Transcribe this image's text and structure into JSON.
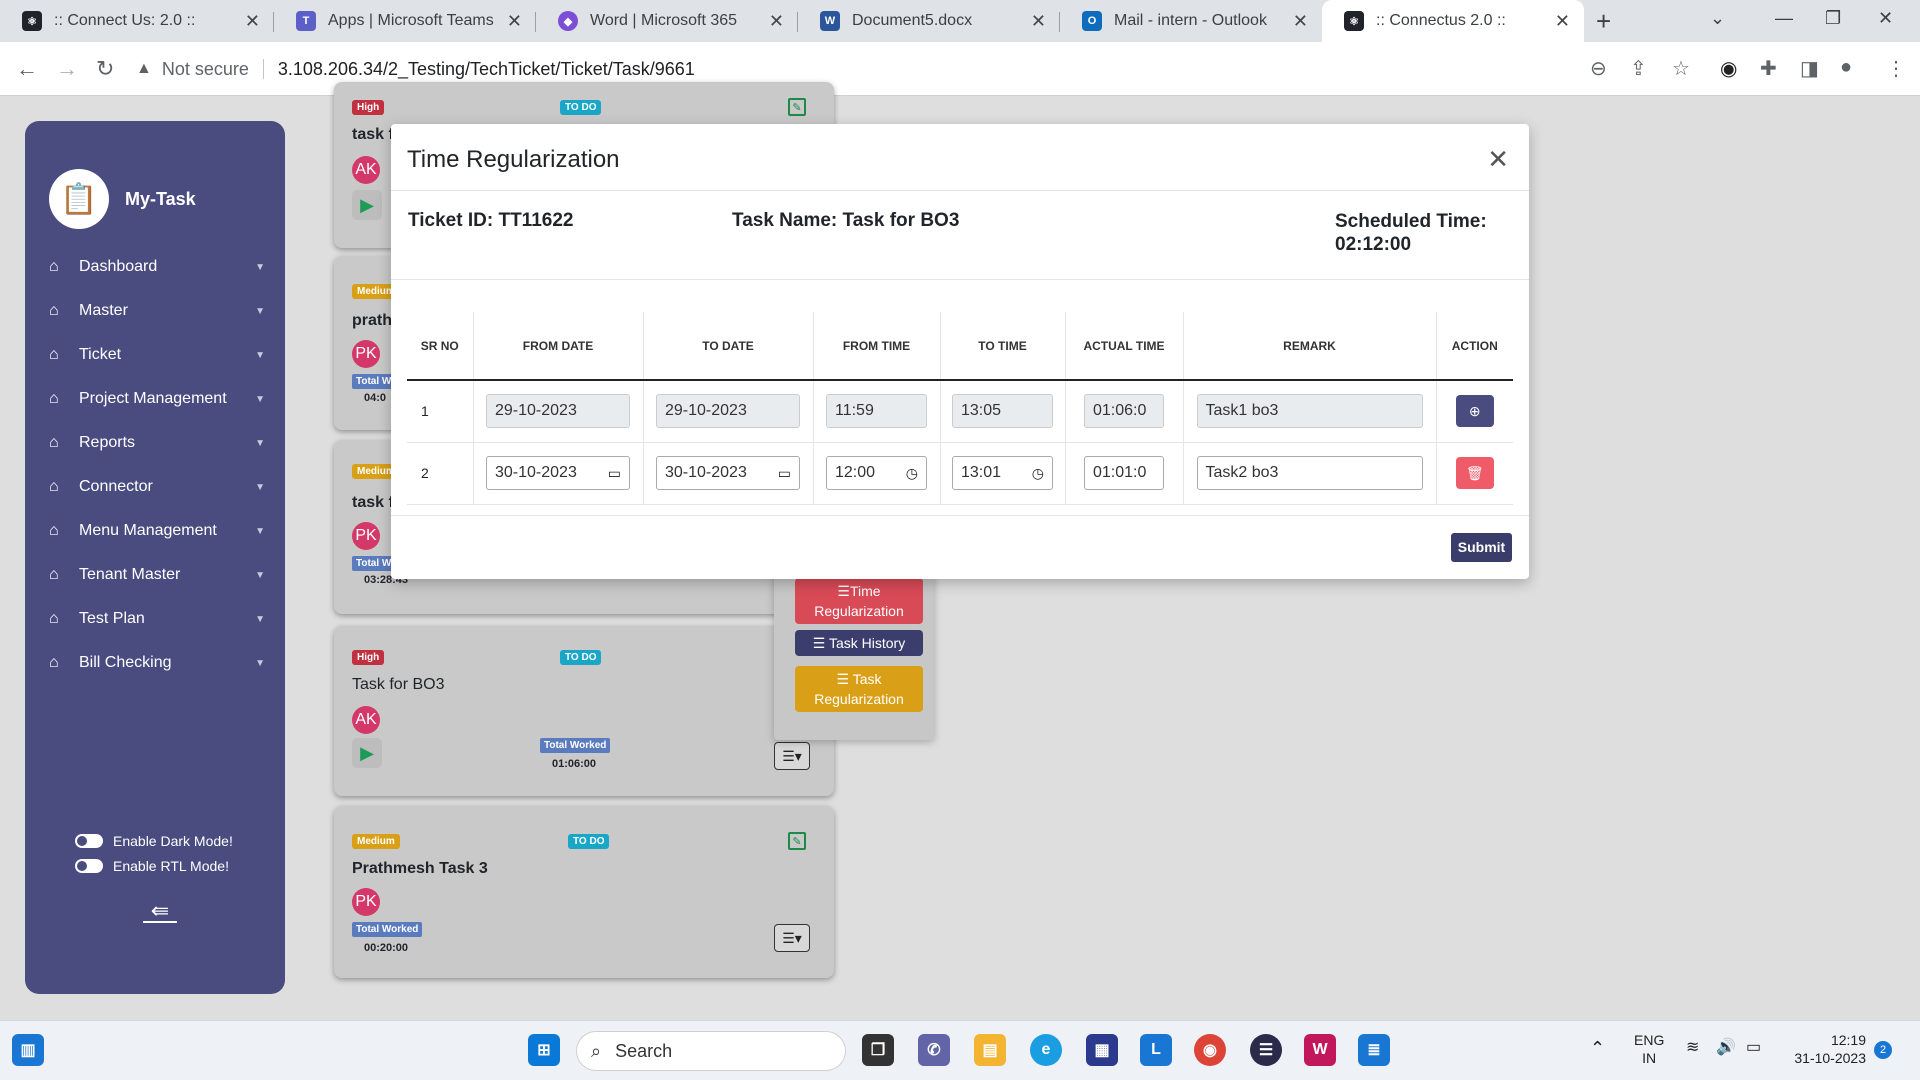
{
  "browser": {
    "tabs": [
      {
        "title": ":: Connect Us: 2.0 ::",
        "icon": "react-icon",
        "color": "#20232a"
      },
      {
        "title": "Apps | Microsoft Teams cla",
        "icon": "teams-icon",
        "color": "#5b5fc7"
      },
      {
        "title": "Word | Microsoft 365",
        "icon": "m365-icon",
        "color": "#7b4fd6"
      },
      {
        "title": "Document5.docx",
        "icon": "word-icon",
        "color": "#2b579a"
      },
      {
        "title": "Mail - intern - Outlook",
        "icon": "outlook-icon",
        "color": "#0f6cbd"
      },
      {
        "title": ":: Connectus 2.0 ::",
        "icon": "react-icon",
        "color": "#20232a"
      }
    ],
    "security_label": "Not secure",
    "url": "3.108.206.34/2_Testing/TechTicket/Ticket/Task/9661"
  },
  "sidebar": {
    "brand": "My-Task",
    "items": [
      {
        "label": "Dashboard"
      },
      {
        "label": "Master"
      },
      {
        "label": "Ticket"
      },
      {
        "label": "Project Management"
      },
      {
        "label": "Reports"
      },
      {
        "label": "Connector"
      },
      {
        "label": "Menu Management"
      },
      {
        "label": "Tenant Master"
      },
      {
        "label": "Test Plan"
      },
      {
        "label": "Bill Checking"
      }
    ],
    "dark_mode_label": "Enable Dark Mode!",
    "rtl_mode_label": "Enable RTL Mode!"
  },
  "cards": [
    {
      "priority": "High",
      "status": "TO DO",
      "title": "task f",
      "avatar": "AK"
    },
    {
      "priority": "Medium",
      "title": "prath",
      "avatar": "PK",
      "total_worked_label": "Total Wo",
      "time": "04:0"
    },
    {
      "priority": "Medium",
      "title": "task f",
      "avatar": "PK",
      "total_worked_label": "Total Wo",
      "time": "03:28:43"
    },
    {
      "priority": "High",
      "status": "TO DO",
      "title": "Task for BO3",
      "avatar": "AK",
      "total_worked_label": "Total Worked",
      "time": "01:06:00"
    },
    {
      "priority": "Medium",
      "status": "TO DO",
      "title": "Prathmesh Task 3",
      "avatar": "PK",
      "total_worked_label": "Total Worked",
      "time": "00:20:00"
    }
  ],
  "dropdown": {
    "time_regularization": "Time Regularization",
    "task_history": "Task History",
    "task_regularization": "Task Regularization"
  },
  "modal": {
    "title": "Time Regularization",
    "ticket_id_label": "Ticket ID:",
    "ticket_id": "TT11622",
    "task_name_label": "Task Name:",
    "task_name": "Task for BO3",
    "scheduled_label": "Scheduled Time:",
    "scheduled_time": "02:12:00",
    "columns": [
      "SR NO",
      "FROM DATE",
      "TO DATE",
      "FROM TIME",
      "TO TIME",
      "ACTUAL TIME",
      "REMARK",
      "ACTION"
    ],
    "rows": [
      {
        "sr": "1",
        "from_date": "29-10-2023",
        "to_date": "29-10-2023",
        "from_time": "11:59",
        "to_time": "13:05",
        "actual_time": "01:06:0",
        "remark": "Task1 bo3"
      },
      {
        "sr": "2",
        "from_date": "30-10-2023",
        "to_date": "30-10-2023",
        "from_time": "12:00",
        "to_time": "13:01",
        "actual_time": "01:01:0",
        "remark": "Task2 bo3"
      }
    ],
    "submit_label": "Submit"
  },
  "taskbar": {
    "search_placeholder": "Search",
    "lang": "ENG",
    "region": "IN",
    "time": "12:19",
    "date": "31-10-2023",
    "notification_count": "2"
  }
}
